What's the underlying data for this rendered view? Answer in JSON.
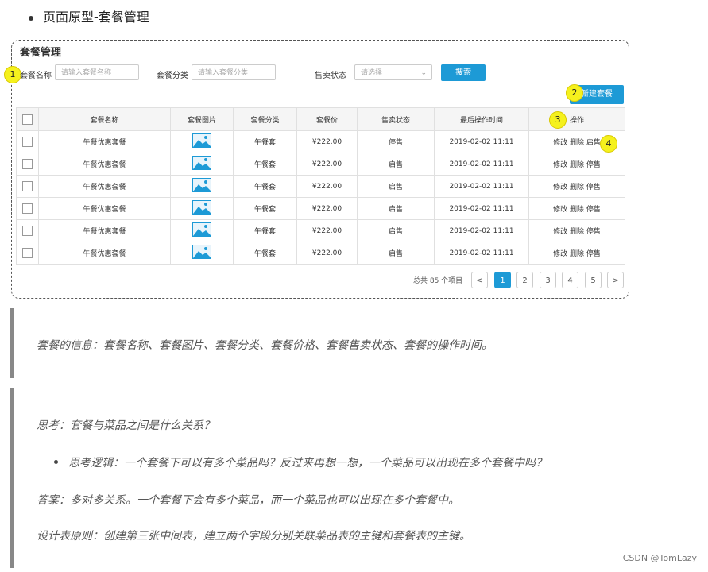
{
  "top_bullet": "页面原型-套餐管理",
  "mock": {
    "title": "套餐管理",
    "filters": {
      "name_label": "套餐名称",
      "name_placeholder": "请输入套餐名称",
      "category_label": "套餐分类",
      "category_placeholder": "请输入套餐分类",
      "status_label": "售卖状态",
      "status_placeholder": "请选择"
    },
    "search_button": "搜索",
    "new_button": "新建套餐",
    "markers": [
      "1",
      "2",
      "3",
      "4"
    ],
    "table": {
      "headers": [
        "套餐名称",
        "套餐图片",
        "套餐分类",
        "套餐价",
        "售卖状态",
        "最后操作时间",
        "操作"
      ],
      "rows": [
        {
          "name": "午餐优惠套餐",
          "category": "午餐套",
          "price": "¥222.00",
          "status": "停售",
          "time": "2019-02-02 11:11",
          "actions": [
            "修改",
            "删除",
            "启售"
          ]
        },
        {
          "name": "午餐优惠套餐",
          "category": "午餐套",
          "price": "¥222.00",
          "status": "启售",
          "time": "2019-02-02 11:11",
          "actions": [
            "修改",
            "删除",
            "停售"
          ]
        },
        {
          "name": "午餐优惠套餐",
          "category": "午餐套",
          "price": "¥222.00",
          "status": "启售",
          "time": "2019-02-02 11:11",
          "actions": [
            "修改",
            "删除",
            "停售"
          ]
        },
        {
          "name": "午餐优惠套餐",
          "category": "午餐套",
          "price": "¥222.00",
          "status": "启售",
          "time": "2019-02-02 11:11",
          "actions": [
            "修改",
            "删除",
            "停售"
          ]
        },
        {
          "name": "午餐优惠套餐",
          "category": "午餐套",
          "price": "¥222.00",
          "status": "启售",
          "time": "2019-02-02 11:11",
          "actions": [
            "修改",
            "删除",
            "停售"
          ]
        },
        {
          "name": "午餐优惠套餐",
          "category": "午餐套",
          "price": "¥222.00",
          "status": "启售",
          "time": "2019-02-02 11:11",
          "actions": [
            "修改",
            "删除",
            "停售"
          ]
        }
      ]
    },
    "pagination": {
      "total": "总共 85 个项目",
      "prev": "<",
      "pages": [
        "1",
        "2",
        "3",
        "4",
        "5"
      ],
      "next": ">",
      "current": "1"
    }
  },
  "quote1": "套餐的信息：套餐名称、套餐图片、套餐分类、套餐价格、套餐售卖状态、套餐的操作时间。",
  "quote2": {
    "question": "思考：套餐与菜品之间是什么关系？",
    "bullet": "思考逻辑：一个套餐下可以有多个菜品吗？反过来再想一想，一个菜品可以出现在多个套餐中吗？",
    "answer": "答案：多对多关系。一个套餐下会有多个菜品，而一个菜品也可以出现在多个套餐中。",
    "principle": "设计表原则：创建第三张中间表，建立两个字段分别关联菜品表的主键和套餐表的主键。"
  },
  "watermark": "CSDN @TomLazy",
  "colors": {
    "accent": "#1d9ad6",
    "marker": "#f5f11d"
  }
}
